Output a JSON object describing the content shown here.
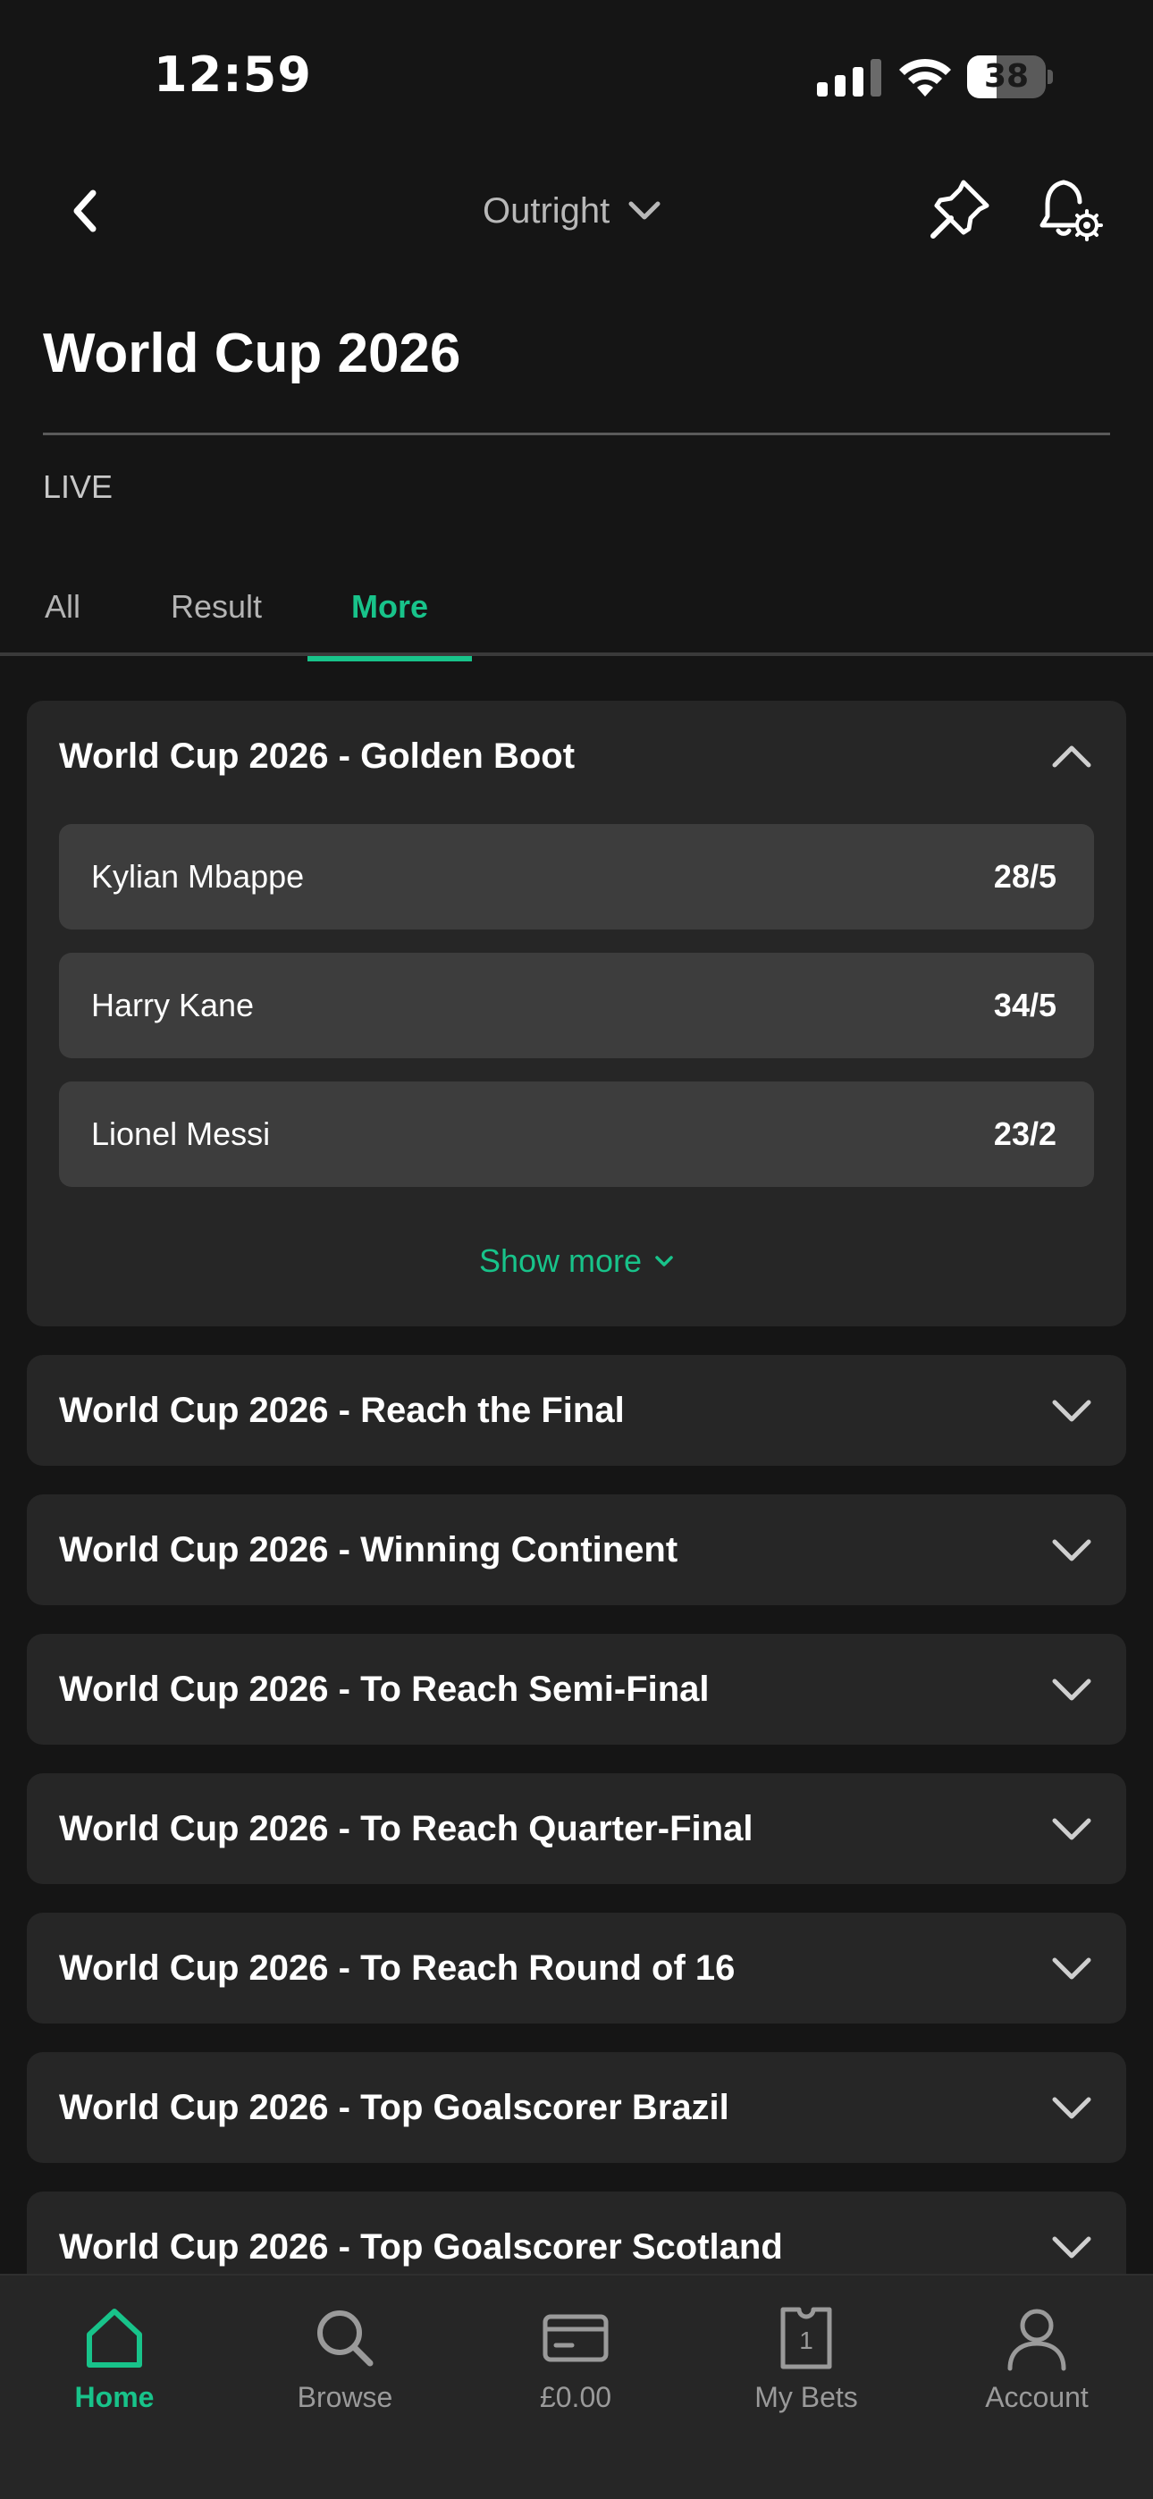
{
  "status_bar": {
    "time": "12:59",
    "battery": "38",
    "battery_level": 0.38
  },
  "header": {
    "market_selector": "Outright"
  },
  "page": {
    "title": "World Cup 2026",
    "live_label": "LIVE"
  },
  "tabs": [
    {
      "label": "All",
      "active": false
    },
    {
      "label": "Result",
      "active": false
    },
    {
      "label": "More",
      "active": true
    }
  ],
  "expanded_market": {
    "title": "World Cup 2026 - Golden Boot",
    "selections": [
      {
        "name": "Kylian Mbappe",
        "odds": "28/5"
      },
      {
        "name": "Harry Kane",
        "odds": "34/5"
      },
      {
        "name": "Lionel Messi",
        "odds": "23/2"
      }
    ],
    "show_more_label": "Show more"
  },
  "collapsed_markets": [
    "World Cup 2026 - Reach the Final",
    "World Cup 2026 - Winning Continent",
    "World Cup 2026 - To Reach Semi-Final",
    "World Cup 2026 - To Reach Quarter-Final",
    "World Cup 2026 - To Reach Round of 16",
    "World Cup 2026 - Top Goalscorer Brazil",
    "World Cup 2026 - Top Goalscorer Scotland"
  ],
  "bottom_nav": [
    {
      "label": "Home",
      "icon": "home-icon",
      "active": true
    },
    {
      "label": "Browse",
      "icon": "search-icon",
      "active": false
    },
    {
      "label": "£0.00",
      "icon": "wallet-card-icon",
      "active": false
    },
    {
      "label": "My Bets",
      "icon": "bet-slip-icon",
      "badge": "1",
      "active": false
    },
    {
      "label": "Account",
      "icon": "account-icon",
      "active": false
    }
  ],
  "colors": {
    "accent": "#18c38a",
    "background": "#151515",
    "card": "#262626",
    "selection": "#3d3d3d"
  }
}
